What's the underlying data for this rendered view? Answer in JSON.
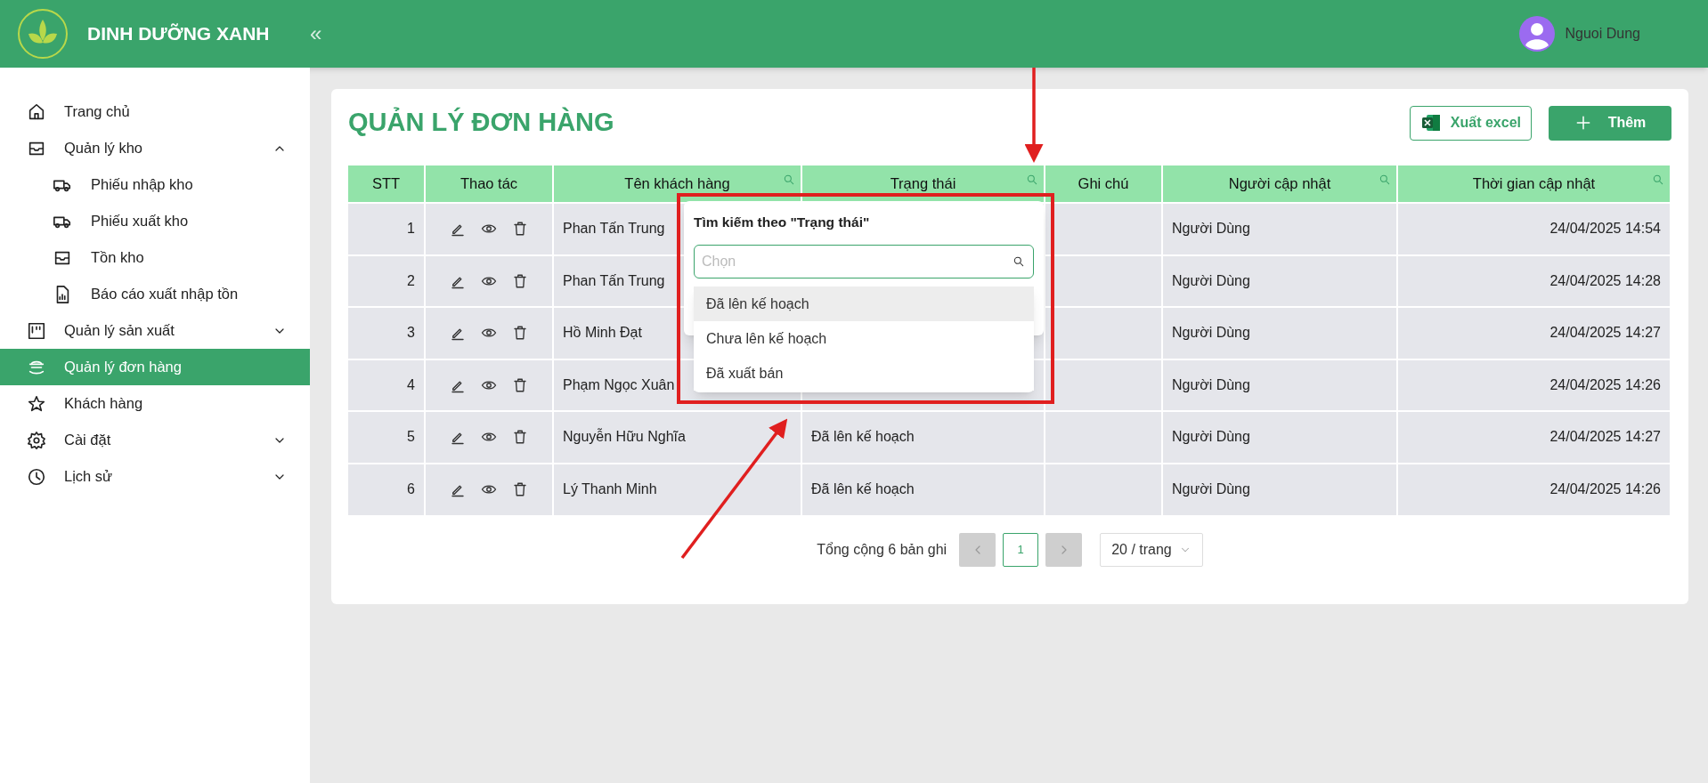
{
  "brand": {
    "name": "DINH DƯỠNG XANH",
    "collapse": "«"
  },
  "user": {
    "name": "Nguoi Dung"
  },
  "sidebar": {
    "items": [
      {
        "label": "Trang chủ",
        "selected": false
      },
      {
        "label": "Quản lý kho",
        "selected": false,
        "expanded": true,
        "children": [
          {
            "label": "Phiếu nhập kho",
            "selected": false
          },
          {
            "label": "Phiếu xuất kho",
            "selected": false
          },
          {
            "label": "Tồn kho",
            "selected": false
          },
          {
            "label": "Báo cáo xuất nhập tồn",
            "selected": false
          }
        ]
      },
      {
        "label": "Quản lý sản xuất",
        "selected": false,
        "expanded": false
      },
      {
        "label": "Quản lý đơn hàng",
        "selected": true
      },
      {
        "label": "Khách hàng",
        "selected": false
      },
      {
        "label": "Cài đặt",
        "selected": false,
        "expanded": false
      },
      {
        "label": "Lịch sử",
        "selected": false,
        "expanded": false
      }
    ]
  },
  "page": {
    "title": "QUẢN LÝ ĐƠN HÀNG",
    "buttons": [
      {
        "kind": "excel",
        "label": "Xuất excel"
      },
      {
        "kind": "add",
        "label": "Thêm"
      }
    ]
  },
  "table": {
    "columns": [
      {
        "label": "STT",
        "searchable": false
      },
      {
        "label": "Thao tác",
        "searchable": false
      },
      {
        "label": "Tên khách hàng",
        "searchable": true
      },
      {
        "label": "Trạng thái",
        "searchable": true
      },
      {
        "label": "Ghi chú",
        "searchable": false
      },
      {
        "label": "Người cập nhật",
        "searchable": true
      },
      {
        "label": "Thời gian cập nhật",
        "searchable": true
      }
    ],
    "rows": [
      {
        "stt": "1",
        "customer": "Phan Tấn Trung",
        "updater": "Người Dùng",
        "time": "24/04/2025 14:54"
      },
      {
        "stt": "2",
        "customer": "Phan Tấn Trung",
        "updater": "Người Dùng",
        "time": "24/04/2025 14:28"
      },
      {
        "stt": "3",
        "customer": "Hồ Minh Đạt",
        "updater": "Người Dùng",
        "time": "24/04/2025 14:27"
      },
      {
        "stt": "4",
        "customer": "Phạm Ngọc Xuân",
        "updater": "Người Dùng",
        "time": "24/04/2025 14:26"
      },
      {
        "stt": "5",
        "customer": "Nguyễn Hữu Nghĩa",
        "status": "Đã lên kế hoạch",
        "updater": "Người Dùng",
        "time": "24/04/2025 14:27"
      },
      {
        "stt": "6",
        "customer": "Lý Thanh Minh",
        "status": "Đã lên kế hoạch",
        "updater": "Người Dùng",
        "time": "24/04/2025 14:26"
      }
    ]
  },
  "filter_popup": {
    "title": "Tìm kiếm theo \"Trạng thái\"",
    "placeholder": "Chọn",
    "options": [
      {
        "label": "Đã lên kế hoạch",
        "highlighted": true
      },
      {
        "label": "Chưa lên kế hoạch",
        "highlighted": false
      },
      {
        "label": "Đã xuất bán",
        "highlighted": false
      }
    ]
  },
  "pagination": {
    "total": "Tổng cộng 6 bản ghi",
    "pages": [
      {
        "label": "1",
        "selected": true
      }
    ],
    "page_size": "20 / trang"
  }
}
